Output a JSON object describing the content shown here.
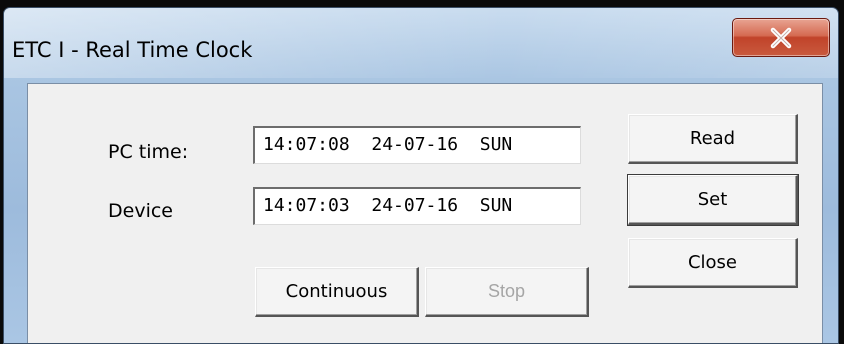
{
  "window": {
    "title": "ETC I - Real Time Clock",
    "close_glyph": "X"
  },
  "form": {
    "pc_time_label": "PC time:",
    "pc_time_value": "14:07:08  24-07-16  SUN",
    "device_label": "Device",
    "device_value": "14:07:03  24-07-16  SUN"
  },
  "buttons": {
    "read": "Read",
    "set": "Set",
    "close": "Close",
    "continuous": "Continuous",
    "stop": "Stop",
    "stop_enabled": false
  },
  "colors": {
    "title_bar": "#a9c5e2",
    "close_button": "#c1432a",
    "dialog_background": "#f0f0f0",
    "disabled_text": "#a5a5a5"
  }
}
